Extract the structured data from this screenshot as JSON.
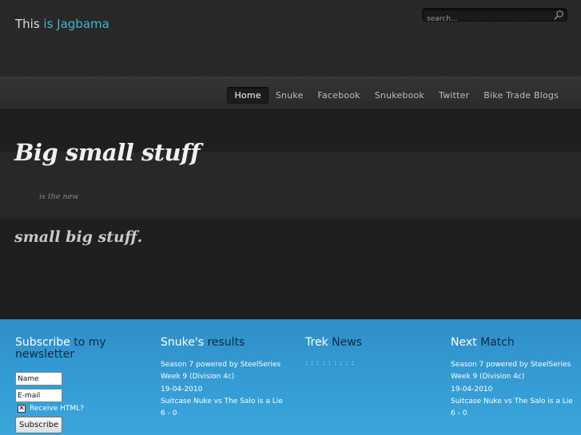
{
  "header": {
    "title_prefix": "This ",
    "title_accent": "is Jagbama",
    "search_placeholder": "search..."
  },
  "nav": {
    "items": [
      {
        "label": "Home",
        "active": true
      },
      {
        "label": "Snuke"
      },
      {
        "label": "Facebook"
      },
      {
        "label": "Snukebook"
      },
      {
        "label": "Twitter"
      },
      {
        "label": "Bike Trade Blogs"
      }
    ]
  },
  "hero": {
    "headline": "Big small stuff",
    "connector": "is the new",
    "subheadline": "small big stuff."
  },
  "footer": {
    "subscribe": {
      "title_light": "Subscribe",
      "title_dark": " to my newsletter",
      "name_placeholder": "Name",
      "email_placeholder": "E-mail",
      "checkbox_label": "Receive HTML?",
      "button_label": "Subscribe"
    },
    "results": {
      "title_light": "Snuke's",
      "title_dark": " results",
      "lines": [
        "Season 7 powered by SteelSeries",
        "Week 9 (Division 4c)",
        "19-04-2010",
        "Suitcase Nuke vs The Salo is a Lie",
        "6 - 0"
      ]
    },
    "news": {
      "title_light": "Trek",
      "title_dark": " News",
      "dots": ": : : : : : : : :"
    },
    "next_match": {
      "title_light": "Next",
      "title_dark": " Match",
      "lines": [
        "Season 7 powered by SteelSeries",
        "Week 9 (Division 4c)",
        "19-04-2010",
        "Suitcase Nuke vs The Salo is a Lie",
        "6 - 0"
      ]
    }
  },
  "colors": {
    "accent": "#3fb5d6",
    "footer_blue": "#3aa6dc",
    "footer_dark_text": "#0f2a44"
  }
}
